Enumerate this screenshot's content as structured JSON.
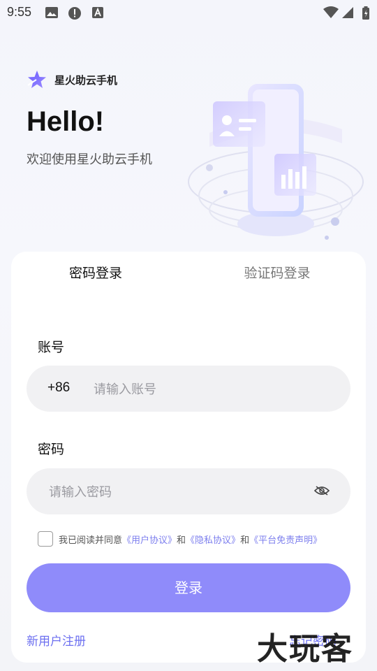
{
  "status_bar": {
    "time": "9:55"
  },
  "brand": {
    "name": "星火助云手机"
  },
  "hero": {
    "greeting": "Hello!",
    "subtitle": "欢迎使用星火助云手机"
  },
  "tabs": [
    {
      "label": "密码登录",
      "active": true
    },
    {
      "label": "验证码登录",
      "active": false
    }
  ],
  "account": {
    "label": "账号",
    "prefix": "+86",
    "placeholder": "请输入账号",
    "value": ""
  },
  "password": {
    "label": "密码",
    "placeholder": "请输入密码",
    "value": ""
  },
  "agreement": {
    "prefix": "我已阅读并同意",
    "user_agreement": "《用户协议》",
    "and1": "和",
    "privacy": "《隐私协议》",
    "and2": "和",
    "disclaimer": "《平台免责声明》"
  },
  "login_button": "登录",
  "register_link": "新用户注册",
  "forgot_link": "忘记密码",
  "watermark": "大玩客",
  "colors": {
    "accent": "#8f8bfa",
    "link": "#6c6ff0",
    "field_bg": "#f1f1f3"
  }
}
